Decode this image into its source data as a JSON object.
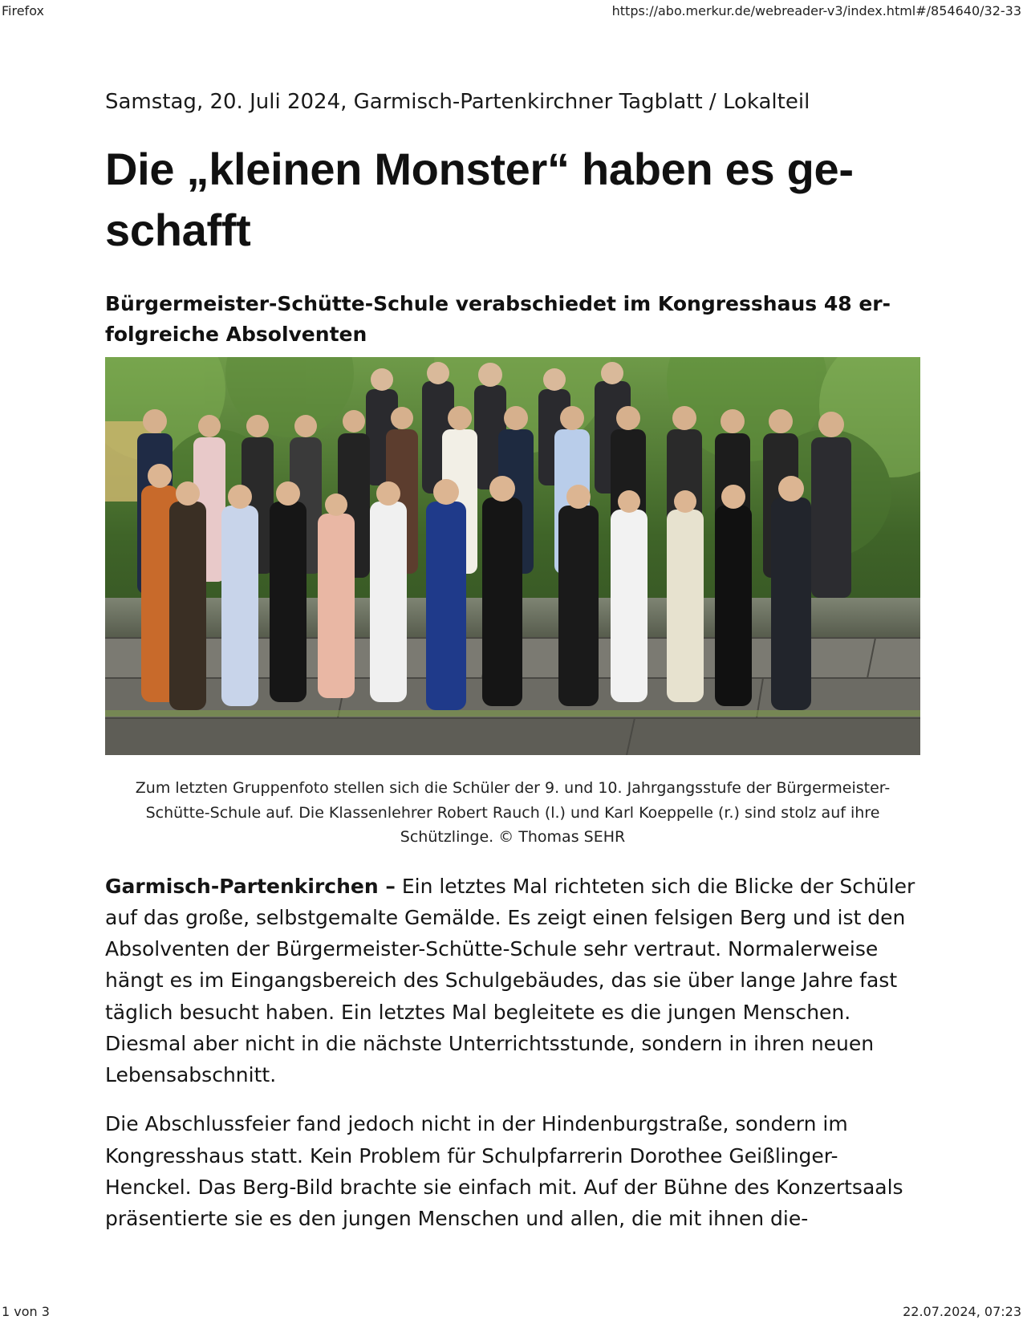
{
  "browser": {
    "app_name": "Firefox",
    "url": "https://abo.merkur.de/webreader-v3/index.html#/854640/32-33",
    "page_indicator": "1 von 3",
    "timestamp": "22.07.2024, 07:23"
  },
  "article": {
    "dateline": "Samstag, 20. Juli 2024, Garmisch-Partenkirchner Tagblatt / Lokalteil",
    "headline": "Die „kleinen Monster“ haben es ge­schafft",
    "subheadline": "Bürgermeister-Schütte-Schule verabschiedet im Kongresshaus 48 er­folgreiche Absolventen",
    "caption": "Zum letzten Gruppenfoto stellen sich die Schüler der 9. und 10. Jahrgangsstufe der Bürgermeister-Schütte-Schule auf. Die Klassenlehrer Robert Rauch (l.) und Karl Koeppelle (r.) sind stolz auf ihre Schützlinge. © Thomas SEHR",
    "paragraph1_lead": "Garmisch-Partenkirchen –",
    "paragraph1": " Ein letztes Mal richteten sich die Blicke der Schü­ler auf das große, selbstgemalte Gemälde. Es zeigt einen felsigen Berg und ist den Absolventen der Bürgermeister-Schütte-Schule sehr vertraut. Normaler­weise hängt es im Eingangsbereich des Schulgebäudes, das sie über lange Jahre fast täglich besucht haben. Ein letztes Mal begleitete es die jungen Menschen. Diesmal aber nicht in die nächste Unterrichtsstunde, sondern in ihren neuen Lebensabschnitt.",
    "paragraph2": "Die Abschlussfeier fand jedoch nicht in der Hindenburgstraße, sondern im Kongresshaus statt. Kein Problem für Schulpfarrerin Dorothee Geißlinger-Henckel. Das Berg-Bild brachte sie einfach mit. Auf der Bühne des Konzert­saals präsentierte sie es den jungen Menschen und allen, die mit ihnen die-"
  },
  "photo_colors": {
    "foliage": "#4f7a35",
    "foliage_dark": "#2f4f1f",
    "stone": "#8b8a82",
    "stone_dark": "#5d5c55"
  }
}
